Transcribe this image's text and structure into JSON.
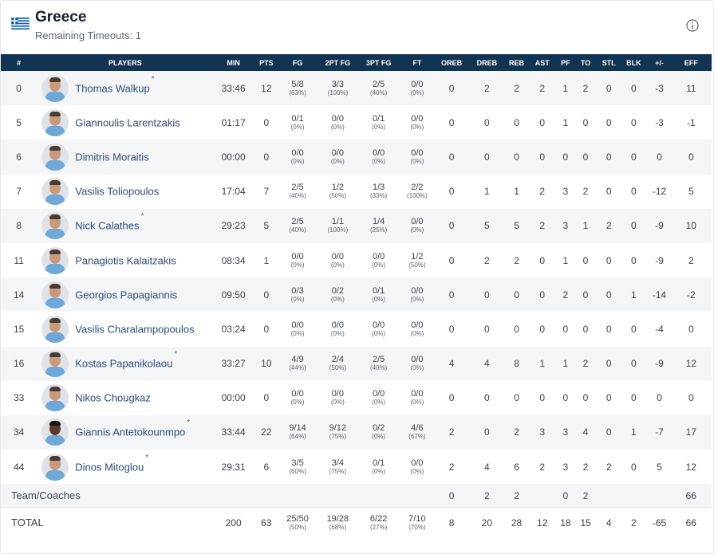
{
  "team": {
    "name": "Greece",
    "remaining_timeouts": "Remaining Timeouts: 1",
    "flag_icon": "greece-flag-icon",
    "info_icon": "info-icon"
  },
  "columns": [
    "#",
    "PLAYERS",
    "MIN",
    "PTS",
    "FG",
    "2PT FG",
    "3PT FG",
    "FT",
    "OREB",
    "DREB",
    "REB",
    "AST",
    "PF",
    "TO",
    "STL",
    "BLK",
    "+/-",
    "EFF"
  ],
  "players": [
    {
      "no": "0",
      "name": "Thomas Walkup",
      "star": "*",
      "min": "33:46",
      "pts": "12",
      "fg": "5/8",
      "fg_pct": "(63%)",
      "p2": "3/3",
      "p2_pct": "(100%)",
      "p3": "2/5",
      "p3_pct": "(40%)",
      "ft": "0/0",
      "ft_pct": "(0%)",
      "oreb": "0",
      "dreb": "2",
      "reb": "2",
      "ast": "2",
      "pf": "1",
      "to": "2",
      "stl": "0",
      "blk": "0",
      "pm": "-3",
      "eff": "11"
    },
    {
      "no": "5",
      "name": "Giannoulis Larentzakis",
      "star": "",
      "min": "01:17",
      "pts": "0",
      "fg": "0/1",
      "fg_pct": "(0%)",
      "p2": "0/0",
      "p2_pct": "(0%)",
      "p3": "0/1",
      "p3_pct": "(0%)",
      "ft": "0/0",
      "ft_pct": "(0%)",
      "oreb": "0",
      "dreb": "0",
      "reb": "0",
      "ast": "0",
      "pf": "1",
      "to": "0",
      "stl": "0",
      "blk": "0",
      "pm": "-3",
      "eff": "-1"
    },
    {
      "no": "6",
      "name": "Dimitris Moraitis",
      "star": "",
      "min": "00:00",
      "pts": "0",
      "fg": "0/0",
      "fg_pct": "(0%)",
      "p2": "0/0",
      "p2_pct": "(0%)",
      "p3": "0/0",
      "p3_pct": "(0%)",
      "ft": "0/0",
      "ft_pct": "(0%)",
      "oreb": "0",
      "dreb": "0",
      "reb": "0",
      "ast": "0",
      "pf": "0",
      "to": "0",
      "stl": "0",
      "blk": "0",
      "pm": "0",
      "eff": "0"
    },
    {
      "no": "7",
      "name": "Vasilis Toliopoulos",
      "star": "",
      "min": "17:04",
      "pts": "7",
      "fg": "2/5",
      "fg_pct": "(40%)",
      "p2": "1/2",
      "p2_pct": "(50%)",
      "p3": "1/3",
      "p3_pct": "(33%)",
      "ft": "2/2",
      "ft_pct": "(100%)",
      "oreb": "0",
      "dreb": "1",
      "reb": "1",
      "ast": "2",
      "pf": "3",
      "to": "2",
      "stl": "0",
      "blk": "0",
      "pm": "-12",
      "eff": "5"
    },
    {
      "no": "8",
      "name": "Nick Calathes",
      "star": "*",
      "min": "29:23",
      "pts": "5",
      "fg": "2/5",
      "fg_pct": "(40%)",
      "p2": "1/1",
      "p2_pct": "(100%)",
      "p3": "1/4",
      "p3_pct": "(25%)",
      "ft": "0/0",
      "ft_pct": "(0%)",
      "oreb": "0",
      "dreb": "5",
      "reb": "5",
      "ast": "2",
      "pf": "3",
      "to": "1",
      "stl": "2",
      "blk": "0",
      "pm": "-9",
      "eff": "10"
    },
    {
      "no": "11",
      "name": "Panagiotis Kalaitzakis",
      "star": "",
      "min": "08:34",
      "pts": "1",
      "fg": "0/0",
      "fg_pct": "(0%)",
      "p2": "0/0",
      "p2_pct": "(0%)",
      "p3": "0/0",
      "p3_pct": "(0%)",
      "ft": "1/2",
      "ft_pct": "(50%)",
      "oreb": "0",
      "dreb": "2",
      "reb": "2",
      "ast": "0",
      "pf": "1",
      "to": "0",
      "stl": "0",
      "blk": "0",
      "pm": "-9",
      "eff": "2"
    },
    {
      "no": "14",
      "name": "Georgios Papagiannis",
      "star": "",
      "min": "09:50",
      "pts": "0",
      "fg": "0/3",
      "fg_pct": "(0%)",
      "p2": "0/2",
      "p2_pct": "(0%)",
      "p3": "0/1",
      "p3_pct": "(0%)",
      "ft": "0/0",
      "ft_pct": "(0%)",
      "oreb": "0",
      "dreb": "0",
      "reb": "0",
      "ast": "0",
      "pf": "2",
      "to": "0",
      "stl": "0",
      "blk": "1",
      "pm": "-14",
      "eff": "-2"
    },
    {
      "no": "15",
      "name": "Vasilis Charalampopoulos",
      "star": "",
      "min": "03:24",
      "pts": "0",
      "fg": "0/0",
      "fg_pct": "(0%)",
      "p2": "0/0",
      "p2_pct": "(0%)",
      "p3": "0/0",
      "p3_pct": "(0%)",
      "ft": "0/0",
      "ft_pct": "(0%)",
      "oreb": "0",
      "dreb": "0",
      "reb": "0",
      "ast": "0",
      "pf": "0",
      "to": "0",
      "stl": "0",
      "blk": "0",
      "pm": "-4",
      "eff": "0"
    },
    {
      "no": "16",
      "name": "Kostas Papanikolaou",
      "star": "*",
      "min": "33:27",
      "pts": "10",
      "fg": "4/9",
      "fg_pct": "(44%)",
      "p2": "2/4",
      "p2_pct": "(50%)",
      "p3": "2/5",
      "p3_pct": "(40%)",
      "ft": "0/0",
      "ft_pct": "(0%)",
      "oreb": "4",
      "dreb": "4",
      "reb": "8",
      "ast": "1",
      "pf": "1",
      "to": "2",
      "stl": "0",
      "blk": "0",
      "pm": "-9",
      "eff": "12"
    },
    {
      "no": "33",
      "name": "Nikos Chougkaz",
      "star": "",
      "min": "00:00",
      "pts": "0",
      "fg": "0/0",
      "fg_pct": "(0%)",
      "p2": "0/0",
      "p2_pct": "(0%)",
      "p3": "0/0",
      "p3_pct": "(0%)",
      "ft": "0/0",
      "ft_pct": "(0%)",
      "oreb": "0",
      "dreb": "0",
      "reb": "0",
      "ast": "0",
      "pf": "0",
      "to": "0",
      "stl": "0",
      "blk": "0",
      "pm": "0",
      "eff": "0"
    },
    {
      "no": "34",
      "name": "Giannis Antetokounmpo",
      "star": "*",
      "min": "33:44",
      "pts": "22",
      "fg": "9/14",
      "fg_pct": "(64%)",
      "p2": "9/12",
      "p2_pct": "(75%)",
      "p3": "0/2",
      "p3_pct": "(0%)",
      "ft": "4/6",
      "ft_pct": "(67%)",
      "oreb": "2",
      "dreb": "0",
      "reb": "2",
      "ast": "3",
      "pf": "3",
      "to": "4",
      "stl": "0",
      "blk": "1",
      "pm": "-7",
      "eff": "17"
    },
    {
      "no": "44",
      "name": "Dinos Mitoglou",
      "star": "*",
      "min": "29:31",
      "pts": "6",
      "fg": "3/5",
      "fg_pct": "(60%)",
      "p2": "3/4",
      "p2_pct": "(75%)",
      "p3": "0/1",
      "p3_pct": "(0%)",
      "ft": "0/0",
      "ft_pct": "(0%)",
      "oreb": "2",
      "dreb": "4",
      "reb": "6",
      "ast": "2",
      "pf": "3",
      "to": "2",
      "stl": "2",
      "blk": "0",
      "pm": "5",
      "eff": "12"
    }
  ],
  "team_coaches": {
    "label": "Team/Coaches",
    "oreb": "0",
    "dreb": "2",
    "reb": "2",
    "pf": "0",
    "to": "2",
    "eff": "66"
  },
  "total": {
    "label": "TOTAL",
    "min": "200",
    "pts": "63",
    "fg": "25/50",
    "fg_pct": "(50%)",
    "p2": "19/28",
    "p2_pct": "(68%)",
    "p3": "6/22",
    "p3_pct": "(27%)",
    "ft": "7/10",
    "ft_pct": "(70%)",
    "oreb": "8",
    "dreb": "20",
    "reb": "28",
    "ast": "12",
    "pf": "18",
    "to": "15",
    "stl": "4",
    "blk": "2",
    "pm": "-65",
    "eff": "66"
  },
  "colors": {
    "header_bg": "#123452",
    "row_alt": "#f4f5f7",
    "player_link": "#2d4a73",
    "flag_blue": "#0d5eaf"
  }
}
